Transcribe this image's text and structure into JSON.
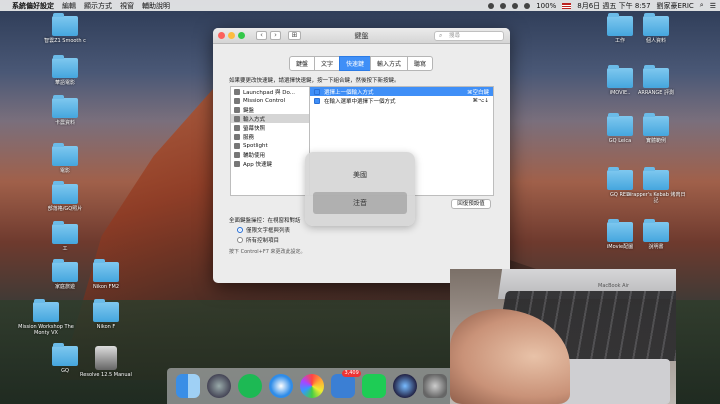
{
  "menubar": {
    "app_name": "系統偏好設定",
    "items": [
      "編輯",
      "顯示方式",
      "視窗",
      "輔助說明"
    ],
    "battery": "100%",
    "datetime": "8月6日 週五 下午 8:57",
    "user": "劉家豪ERIC"
  },
  "desktop_left": [
    "智雲Z1 Smooth c",
    "華語電影",
    "卡農資料",
    "電影",
    "部落格/GQ照片",
    "工",
    "家庭旅遊",
    "Nikon FM2",
    "Mission Workshop The Monty VX",
    "Nikon F",
    "GQ",
    "Resolve 12.5 Manual"
  ],
  "desktop_right": [
    "工作",
    "個人資料",
    "iMOVIE..",
    "ARRANGE 評測",
    "GQ Leica",
    "實體範例",
    "GQ RED",
    "Wrapper's Kebab 烤肉日記",
    "iMovie配圖",
    "說明書"
  ],
  "window": {
    "title": "鍵盤",
    "search_placeholder": "搜尋",
    "tabs": [
      "鍵盤",
      "文字",
      "快速鍵",
      "輸入方式",
      "聽寫"
    ],
    "active_tab": "快速鍵",
    "instruction": "如果要更改快速鍵，請選擇快速鍵，按一下組合鍵，然後按下新按鍵。",
    "categories": [
      "Launchpad 與 Do...",
      "Mission Control",
      "鍵盤",
      "輸入方式",
      "螢幕快照",
      "服務",
      "Spotlight",
      "輔助使用",
      "App 快速鍵"
    ],
    "selected_category": "輸入方式",
    "shortcuts": [
      {
        "name": "選擇上一個輸入方式",
        "key": "⌘空白鍵",
        "selected": true
      },
      {
        "name": "在輸入選單中選擇下一個方式",
        "key": "⌘⌥↓",
        "selected": false
      }
    ],
    "restore_button": "回復預設值",
    "full_keyboard_access": "全面鍵盤操控：在視窗和對話",
    "radio_options": [
      "僅限文字框與列表",
      "所有控制項目"
    ],
    "radio_selected": 0,
    "hint": "按下 Control+F7 來更改此設定。",
    "settings_button": "設定"
  },
  "hud": {
    "items": [
      "美國",
      "注音"
    ],
    "selected": "注音"
  },
  "dock": {
    "badge": "3,409"
  },
  "video": {
    "macbook_label": "MacBook Air"
  }
}
